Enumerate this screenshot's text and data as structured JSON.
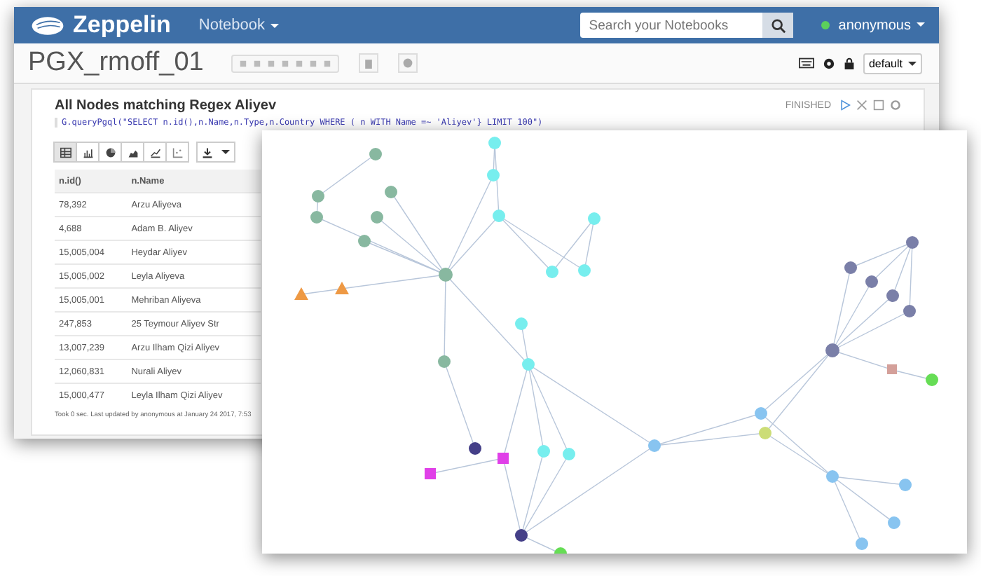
{
  "header": {
    "logo_text": "Zeppelin",
    "menu": "Notebook",
    "search": {
      "placeholder": "Search your Notebooks"
    },
    "user": "anonymous",
    "online": true
  },
  "notebook": {
    "title": "PGX_rmoff_01",
    "interpreter": "default"
  },
  "paragraph": {
    "title": "All Nodes matching Regex Aliyev",
    "code": "G.queryPgql(\"SELECT n.id(),n.Name,n.Type,n.Country WHERE ( n WITH Name =~ 'Aliyev'} LIMIT 100\")",
    "status": "FINISHED",
    "viz_buttons": [
      {
        "kind": "table",
        "selected": true
      },
      {
        "kind": "bar",
        "selected": false
      },
      {
        "kind": "pie",
        "selected": false
      },
      {
        "kind": "area",
        "selected": false
      },
      {
        "kind": "line",
        "selected": false
      },
      {
        "kind": "scatter",
        "selected": false
      }
    ],
    "table": {
      "columns": [
        "n.id()",
        "n.Name"
      ],
      "rows": [
        [
          "78,392",
          "Arzu Aliyeva"
        ],
        [
          "4,688",
          "Adam B. Aliyev"
        ],
        [
          "15,005,004",
          "Heydar Aliyev"
        ],
        [
          "15,005,002",
          "Leyla Aliyeva"
        ],
        [
          "15,005,001",
          "Mehriban Aliyeva"
        ],
        [
          "247,853",
          "25 Teymour Aliyev Str"
        ],
        [
          "13,007,239",
          "Arzu Ilham Qizi Aliyev"
        ],
        [
          "12,060,831",
          "Nurali Aliyev"
        ],
        [
          "15,000,477",
          "Leyla Ilham Qizi Aliyev"
        ]
      ]
    },
    "footer": "Took 0 sec. Last updated by anonymous at January 24 2017, 7:53"
  }
}
